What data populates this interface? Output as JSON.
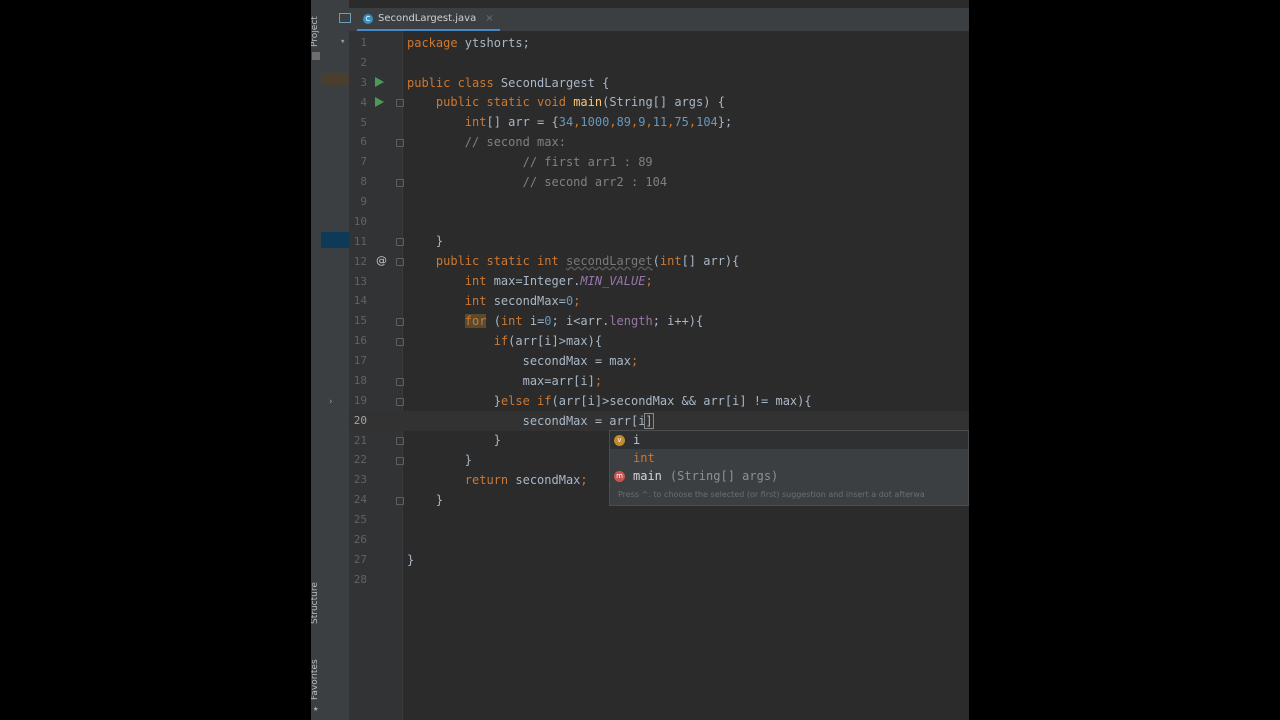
{
  "tool_windows": {
    "project": "Project",
    "structure": "Structure",
    "favorites": "Favorites"
  },
  "tab": {
    "filename": "SecondLargest.java",
    "icon": "class-icon",
    "close": "×"
  },
  "current_line": 20,
  "lines": [
    {
      "n": "1"
    },
    {
      "n": "2"
    },
    {
      "n": "3"
    },
    {
      "n": "4"
    },
    {
      "n": "5"
    },
    {
      "n": "6"
    },
    {
      "n": "7"
    },
    {
      "n": "8"
    },
    {
      "n": "9"
    },
    {
      "n": "10"
    },
    {
      "n": "11"
    },
    {
      "n": "12"
    },
    {
      "n": "13"
    },
    {
      "n": "14"
    },
    {
      "n": "15"
    },
    {
      "n": "16"
    },
    {
      "n": "17"
    },
    {
      "n": "18"
    },
    {
      "n": "19"
    },
    {
      "n": "20"
    },
    {
      "n": "21"
    },
    {
      "n": "22"
    },
    {
      "n": "23"
    },
    {
      "n": "24"
    },
    {
      "n": "25"
    },
    {
      "n": "26"
    },
    {
      "n": "27"
    },
    {
      "n": "28"
    }
  ],
  "code": {
    "l1a": "package ",
    "l1b": "ytshorts;",
    "l3a": "public class ",
    "l3b": "SecondLargest {",
    "l4a": "public static void ",
    "l4b": "main",
    "l4c": "(String[] args) {",
    "l5a": "int",
    "l5b": "[] arr = {",
    "l5c": "34",
    "l5d": "1000",
    "l5e": "89",
    "l5f": "9",
    "l5g": "11",
    "l5h": "75",
    "l5i": "104",
    "l5j": "};",
    "l6": "// second max:",
    "l7": "// first arr1 : 89",
    "l8": "// second arr2 : 104",
    "l11": "}",
    "l12a": "public static int ",
    "l12b": "secondLarget",
    "l12c": "(",
    "l12d": "int",
    "l12e": "[] arr){",
    "l13a": "int ",
    "l13b": "max=Integer.",
    "l13c": "MIN_VALUE",
    "l13d": ";",
    "l14a": "int ",
    "l14b": "secondMax=",
    "l14c": "0",
    "l14d": ";",
    "l15a": "for",
    "l15b": " (",
    "l15c": "int ",
    "l15d": "i=",
    "l15e": "0",
    "l15f": "; i<arr.",
    "l15g": "length",
    "l15h": "; i++){",
    "l16a": "if",
    "l16b": "(arr[i]>max){",
    "l17a": "secondMax = max",
    "l17b": ";",
    "l18a": "max=arr[i]",
    "l18b": ";",
    "l19a": "}",
    "l19b": "else if",
    "l19c": "(arr[i]>secondMax && arr[i] != max){",
    "l20a": "secondMax = arr[i",
    "l21": "}",
    "l22": "}",
    "l23a": "return ",
    "l23b": "secondMax",
    "l24": "}",
    "l27": "}"
  },
  "autocomplete": {
    "items": [
      {
        "icon": "variable-icon",
        "badge": "v",
        "name": "i",
        "signature": ""
      },
      {
        "icon": "none",
        "badge": "",
        "name": "int",
        "signature": ""
      },
      {
        "icon": "method-icon",
        "badge": "m",
        "name": "main",
        "signature": "(String[] args)"
      }
    ],
    "hint": "Press ^. to choose the selected (or first) suggestion and insert a dot afterwa"
  },
  "colors": {
    "background": "#2b2b2b",
    "keyword": "#cc7832",
    "number": "#6897bb",
    "comment": "#808080",
    "method": "#ffc66d",
    "field": "#9876aa"
  }
}
